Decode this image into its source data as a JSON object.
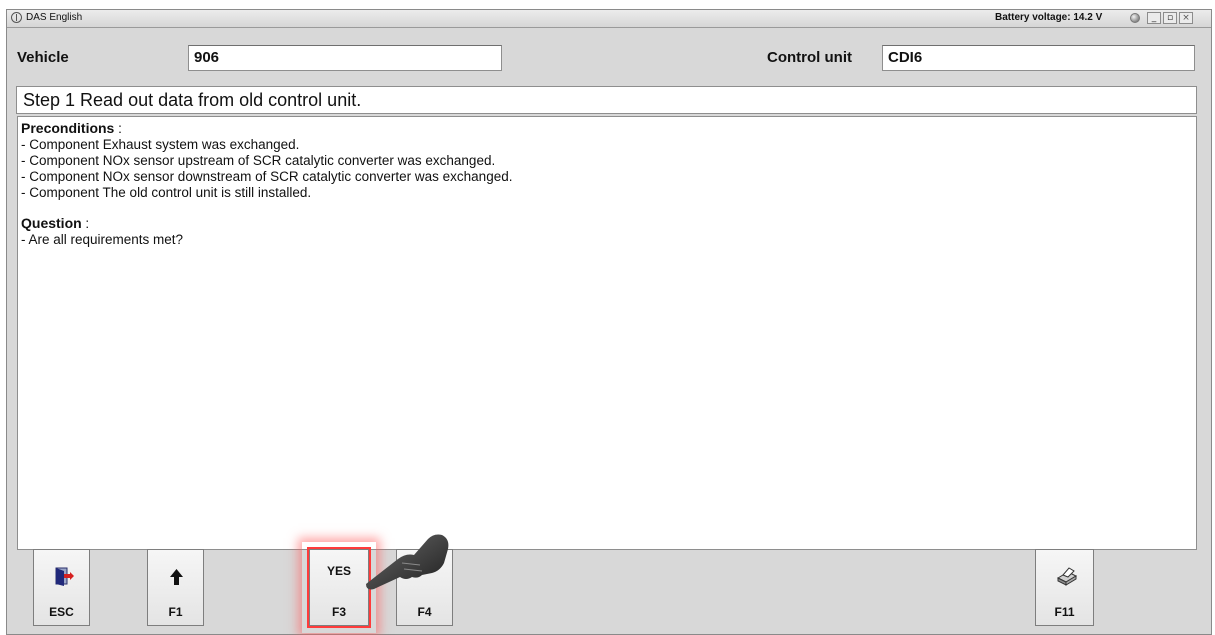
{
  "titlebar": {
    "app_title": "DAS English",
    "battery": "Battery voltage: 14.2 V",
    "min": "_",
    "max": "▫",
    "close": "×"
  },
  "header": {
    "vehicle_label": "Vehicle",
    "vehicle_value": "906",
    "control_unit_label": "Control unit",
    "control_unit_value": "CDI6"
  },
  "step": "Step 1 Read out data from old control unit.",
  "content": {
    "preconditions_title": "Preconditions",
    "preconditions_suffix": " :",
    "preconditions": [
      "- Component Exhaust system was exchanged.",
      "- Component NOx sensor upstream of SCR catalytic converter was exchanged.",
      "- Component NOx sensor downstream of SCR catalytic converter was exchanged.",
      "- Component The old control unit is still installed."
    ],
    "question_title": "Question",
    "question_suffix": " :",
    "questions": [
      "- Are all requirements met?"
    ]
  },
  "fkeys": {
    "esc": "ESC",
    "f1": "F1",
    "f3": "F3",
    "f3_text": "YES",
    "f4": "F4",
    "f11": "F11"
  },
  "icons": {
    "esc": "exit-door-icon",
    "f1": "arrow-up-icon",
    "f11": "printer-icon",
    "pointer": "pointing-hand-icon"
  },
  "colors": {
    "highlight": "#ff3b3b",
    "window_bg": "#d8d8d8"
  }
}
